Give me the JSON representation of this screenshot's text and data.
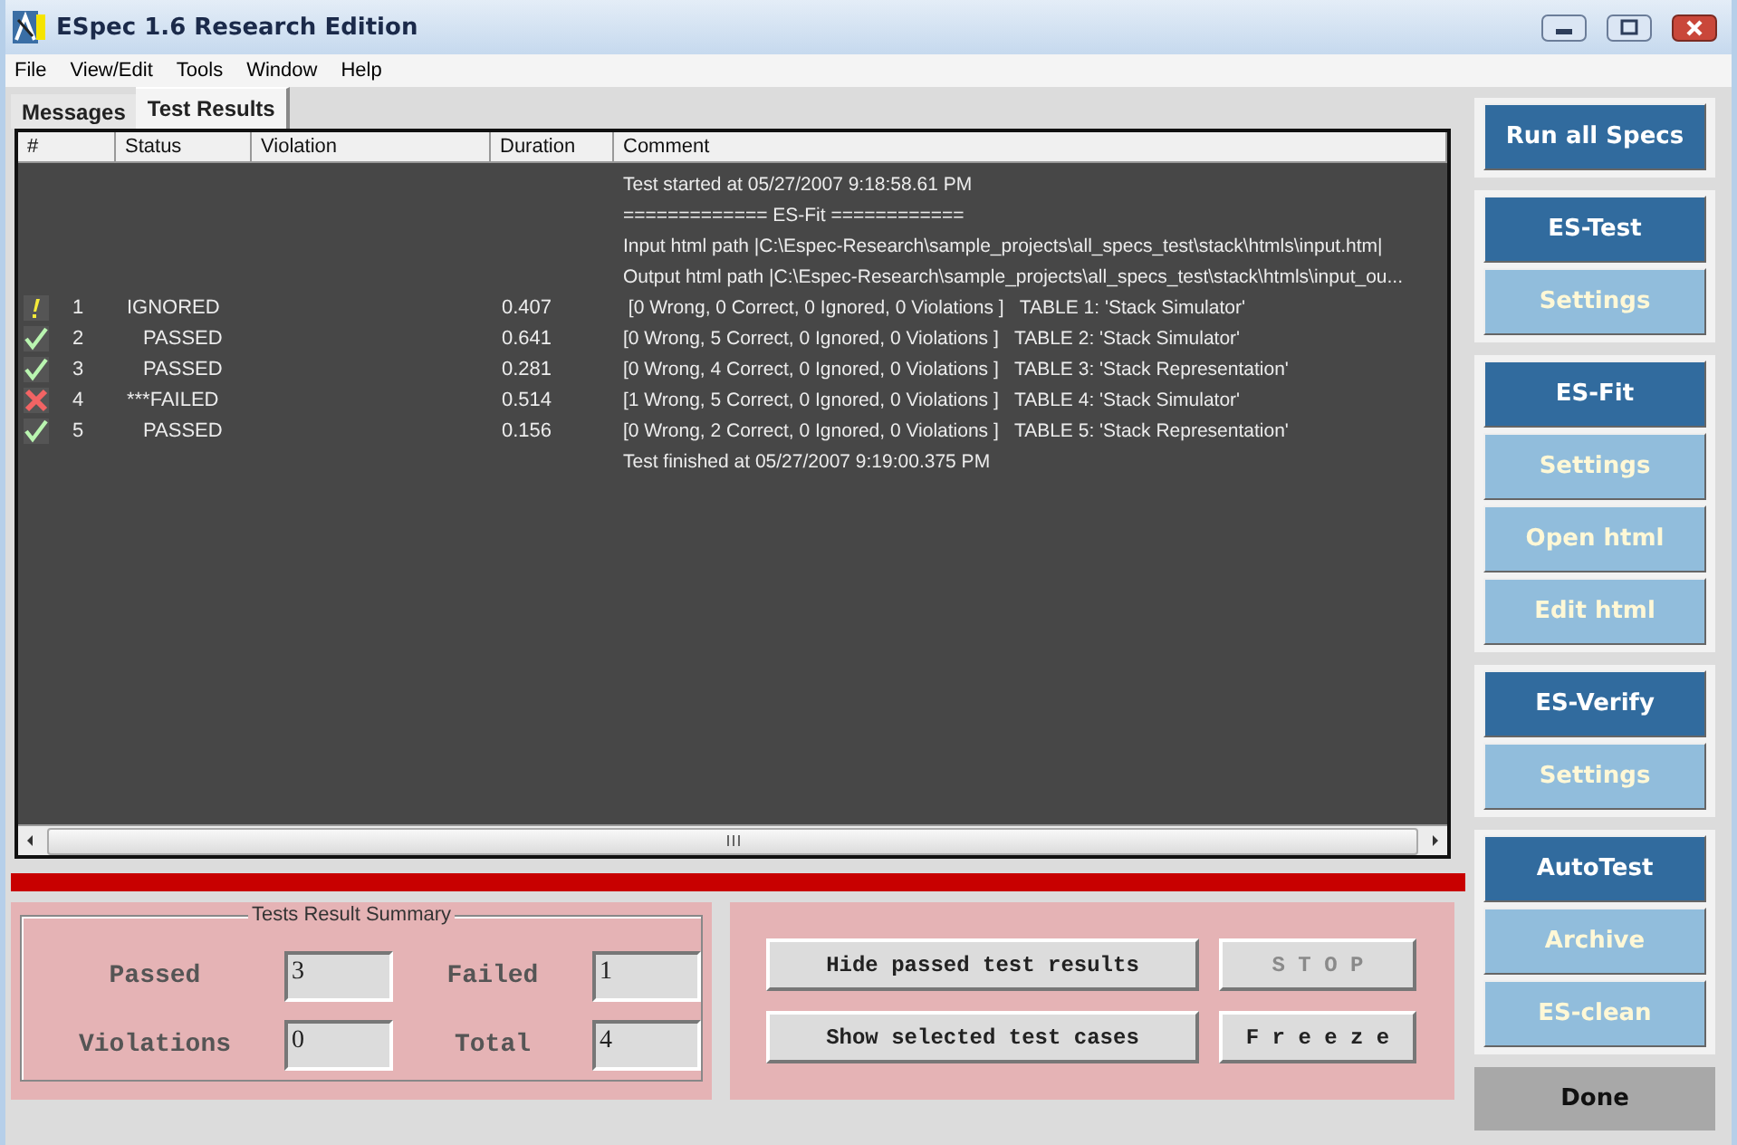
{
  "window": {
    "title": "ESpec 1.6 Research Edition"
  },
  "menu": [
    "File",
    "View/Edit",
    "Tools",
    "Window",
    "Help"
  ],
  "tabs": [
    {
      "label": "Messages",
      "selected": false
    },
    {
      "label": "Test Results",
      "selected": true
    }
  ],
  "table": {
    "columns": [
      "#",
      "Status",
      "Violation",
      "Duration",
      "Comment"
    ],
    "rows": [
      {
        "kind": "message",
        "comment": "Test started at 05/27/2007 9:18:58.61 PM"
      },
      {
        "kind": "message",
        "comment": "============= ES-Fit ============"
      },
      {
        "kind": "message",
        "comment": "Input html path |C:\\Espec-Research\\sample_projects\\all_specs_test\\stack\\htmls\\input.htm|"
      },
      {
        "kind": "message",
        "comment": "Output html path |C:\\Espec-Research\\sample_projects\\all_specs_test\\stack\\htmls\\input_ou..."
      },
      {
        "kind": "ignored",
        "number": "1",
        "status": "IGNORED",
        "duration": "0.407",
        "comment": " [0 Wrong, 0 Correct, 0 Ignored, 0 Violations ]   TABLE 1: 'Stack Simulator'"
      },
      {
        "kind": "passed",
        "number": "2",
        "status": "PASSED",
        "duration": "0.641",
        "comment": "[0 Wrong, 5 Correct, 0 Ignored, 0 Violations ]   TABLE 2: 'Stack Simulator'"
      },
      {
        "kind": "passed",
        "number": "3",
        "status": "PASSED",
        "duration": "0.281",
        "comment": "[0 Wrong, 4 Correct, 0 Ignored, 0 Violations ]   TABLE 3: 'Stack Representation'"
      },
      {
        "kind": "failed",
        "number": "4",
        "status": "***FAILED",
        "duration": "0.514",
        "comment": "[1 Wrong, 5 Correct, 0 Ignored, 0 Violations ]   TABLE 4: 'Stack Simulator'"
      },
      {
        "kind": "passed",
        "number": "5",
        "status": "PASSED",
        "duration": "0.156",
        "comment": "[0 Wrong, 2 Correct, 0 Ignored, 0 Violations ]   TABLE 5: 'Stack Representation'"
      },
      {
        "kind": "message",
        "comment": "Test finished at 05/27/2007 9:19:00.375 PM"
      }
    ]
  },
  "progress": {
    "level": 1
  },
  "summary": {
    "title": "Tests Result Summary",
    "fields": [
      {
        "label": "Passed",
        "value": "3"
      },
      {
        "label": "Failed",
        "value": "1"
      },
      {
        "label": "Violations",
        "value": "0"
      },
      {
        "label": "Total",
        "value": "4"
      }
    ]
  },
  "actions": [
    {
      "label": "Hide passed test results",
      "disabled": false
    },
    {
      "label": "S T O P",
      "disabled": true
    },
    {
      "label": "Show selected test cases",
      "disabled": false
    },
    {
      "label": "F r e e z e",
      "disabled": false
    }
  ],
  "sidebar": {
    "groups": [
      [
        {
          "label": "Run all Specs",
          "kind": "primary"
        }
      ],
      [
        {
          "label": "ES-Test",
          "kind": "primary"
        },
        {
          "label": "Settings",
          "kind": "secondary"
        }
      ],
      [
        {
          "label": "ES-Fit",
          "kind": "primary"
        },
        {
          "label": "Settings",
          "kind": "secondary"
        },
        {
          "label": "Open html",
          "kind": "secondary"
        },
        {
          "label": "Edit html",
          "kind": "secondary"
        }
      ],
      [
        {
          "label": "ES-Verify",
          "kind": "primary"
        },
        {
          "label": "Settings",
          "kind": "secondary"
        }
      ],
      [
        {
          "label": "AutoTest",
          "kind": "primary"
        },
        {
          "label": "Archive",
          "kind": "secondary"
        },
        {
          "label": "ES-clean",
          "kind": "secondary"
        }
      ]
    ],
    "done": "Done"
  }
}
